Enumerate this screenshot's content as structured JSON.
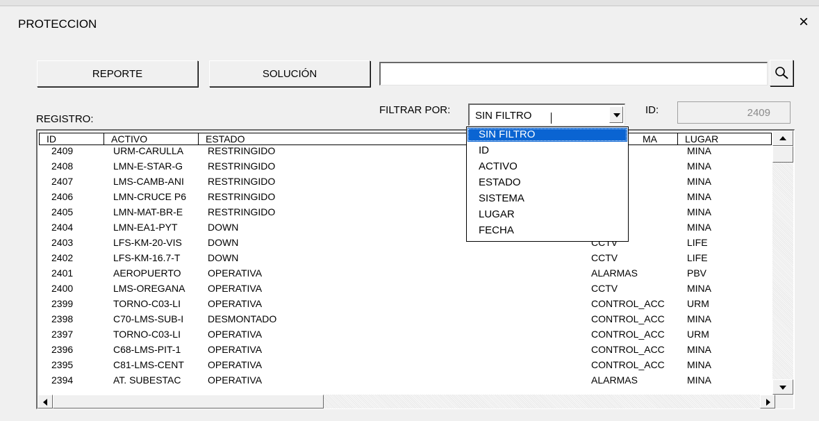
{
  "window": {
    "title": "PROTECCION",
    "close_label": "×"
  },
  "toolbar": {
    "reporte_label": "REPORTE",
    "solucion_label": "SOLUCIÓN",
    "search_value": ""
  },
  "filter": {
    "label": "FILTRAR POR:",
    "selected": "SIN FILTRO",
    "options": [
      "SIN FILTRO",
      "ID",
      "ACTIVO",
      "ESTADO",
      "SISTEMA",
      "LUGAR",
      "FECHA"
    ]
  },
  "id_field": {
    "label": "ID:",
    "value": "2409"
  },
  "registro_label": "REGISTRO:",
  "table": {
    "headers": [
      "ID",
      "ACTIVO",
      "ESTADO",
      "SISTEMA",
      "LUGAR"
    ],
    "header_sistema_visible": "MA",
    "rows": [
      [
        "2409",
        "URM-CARULLA",
        "RESTRINGIDO",
        "",
        "MINA"
      ],
      [
        "2408",
        "LMN-E-STAR-G",
        "RESTRINGIDO",
        "",
        "MINA"
      ],
      [
        "2407",
        "LMS-CAMB-ANI",
        "RESTRINGIDO",
        "",
        "MINA"
      ],
      [
        "2406",
        "LMN-CRUCE P6",
        "RESTRINGIDO",
        "",
        "MINA"
      ],
      [
        "2405",
        "LMN-MAT-BR-E",
        "RESTRINGIDO",
        "",
        "MINA"
      ],
      [
        "2404",
        "LMN-EA1-PYT",
        "DOWN",
        "",
        "MINA"
      ],
      [
        "2403",
        "LFS-KM-20-VIS",
        "DOWN",
        "CCTV",
        "LIFE"
      ],
      [
        "2402",
        "LFS-KM-16.7-T",
        "DOWN",
        "CCTV",
        "LIFE"
      ],
      [
        "2401",
        "AEROPUERTO",
        "OPERATIVA",
        "ALARMAS",
        "PBV"
      ],
      [
        "2400",
        "LMS-OREGANA",
        "OPERATIVA",
        "CCTV",
        "MINA"
      ],
      [
        "2399",
        "TORNO-C03-LI",
        "OPERATIVA",
        "CONTROL_ACC",
        "URM"
      ],
      [
        "2398",
        "C70-LMS-SUB-I",
        "DESMONTADO",
        "CONTROL_ACC",
        "MINA"
      ],
      [
        "2397",
        "TORNO-C03-LI",
        "OPERATIVA",
        "CONTROL_ACC",
        "URM"
      ],
      [
        "2396",
        "C68-LMS-PIT-1",
        "OPERATIVA",
        "CONTROL_ACC",
        "MINA"
      ],
      [
        "2395",
        "C81-LMS-CENT",
        "OPERATIVA",
        "CONTROL_ACC",
        "MINA"
      ],
      [
        "2394",
        "AT. SUBESTAC",
        "OPERATIVA",
        "ALARMAS",
        "MINA"
      ]
    ]
  },
  "colors": {
    "selection": "#0a64d2",
    "window_bg": "#f0f0f0"
  },
  "icons": {
    "search": "magnifier-icon",
    "close": "close-icon"
  }
}
